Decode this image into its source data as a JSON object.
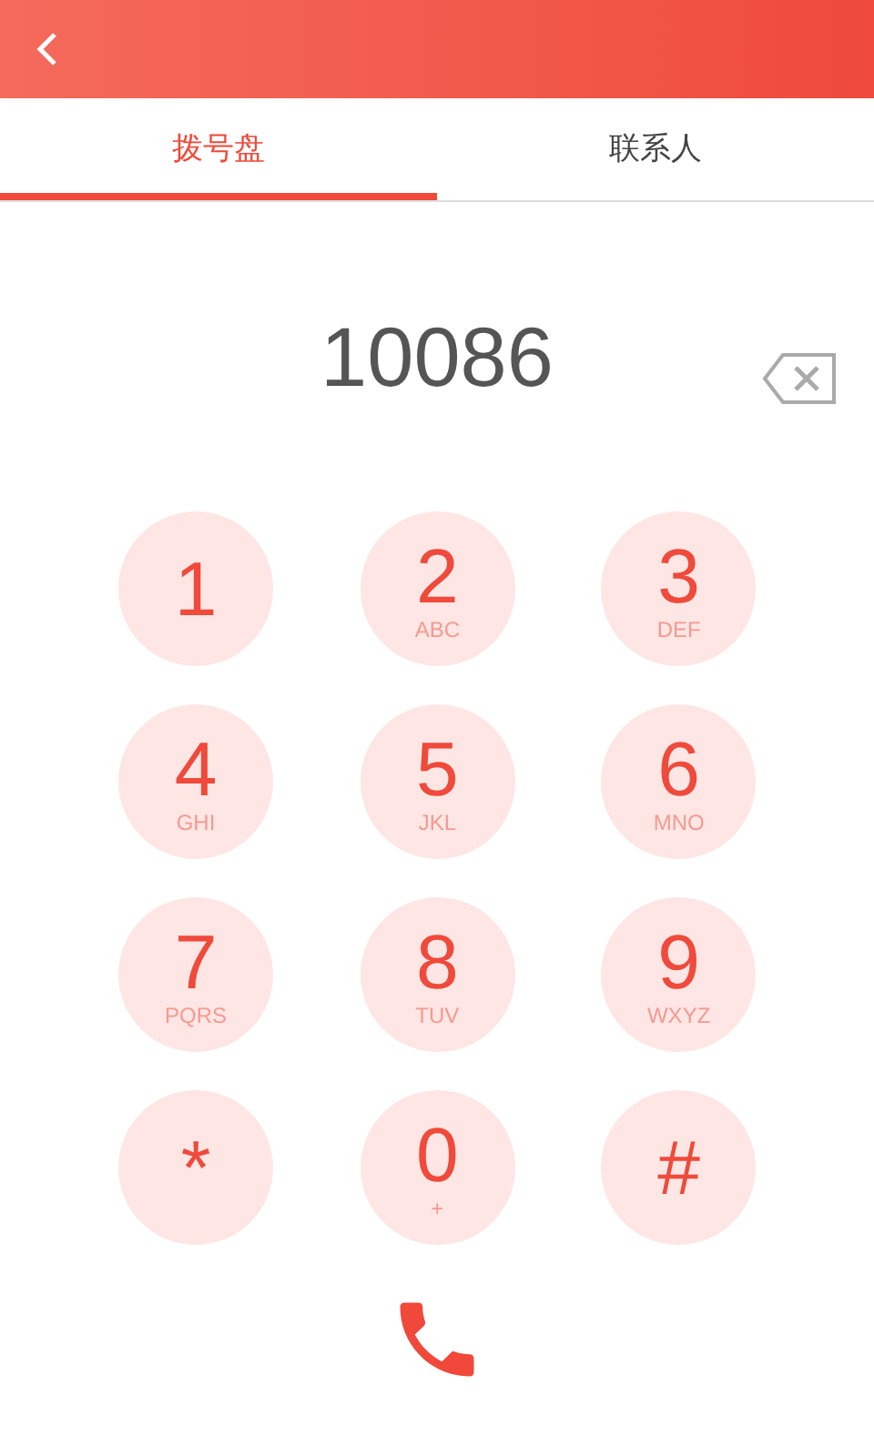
{
  "tabs": [
    {
      "label": "拨号盘",
      "selected": true
    },
    {
      "label": "联系人",
      "selected": false
    }
  ],
  "number": "10086",
  "keys": [
    {
      "digit": "1"
    },
    {
      "digit": "2",
      "letters": "ABC"
    },
    {
      "digit": "3",
      "letters": "DEF"
    },
    {
      "digit": "4",
      "letters": "GHI"
    },
    {
      "digit": "5",
      "letters": "JKL"
    },
    {
      "digit": "6",
      "letters": "MNO"
    },
    {
      "digit": "7",
      "letters": "PQRS"
    },
    {
      "digit": "8",
      "letters": "TUV"
    },
    {
      "digit": "9",
      "letters": "WXYZ"
    },
    {
      "digit": "*"
    },
    {
      "digit": "0",
      "letters": "+"
    },
    {
      "digit": "#"
    }
  ]
}
